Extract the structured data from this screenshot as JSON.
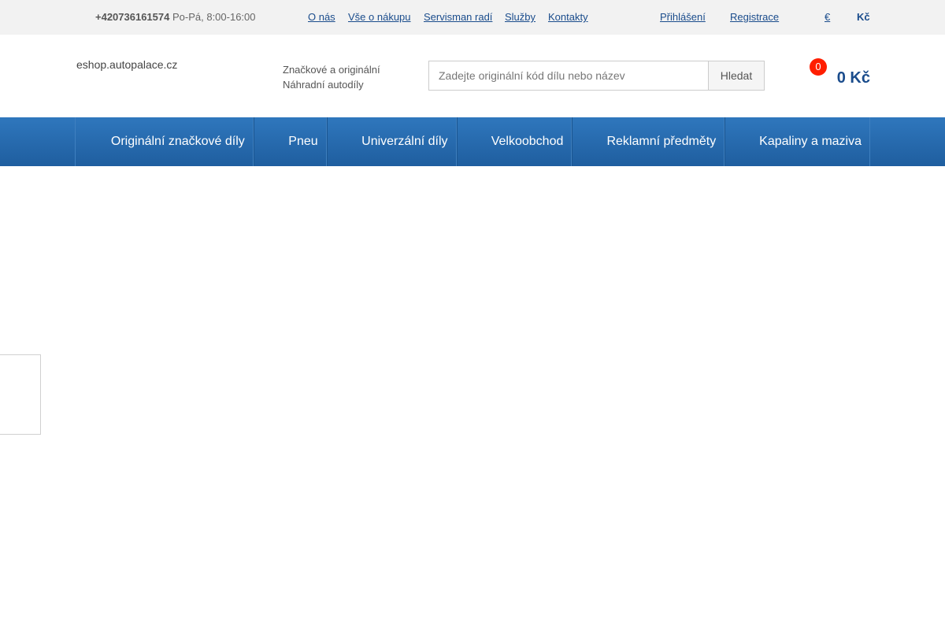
{
  "topbar": {
    "phone_number": "+420736161574",
    "hours": "Po-Pá, 8:00-16:00",
    "links": {
      "about": "O nás",
      "shopping": "Vše o nákupu",
      "advice": "Servisman radí",
      "services": "Služby",
      "contacts": "Kontakty",
      "login": "Přihlášení",
      "register": "Registrace"
    },
    "currencies": {
      "eur": "€",
      "czk": "Kč"
    }
  },
  "header": {
    "logo_alt": "eshop.autopalace.cz",
    "tagline_line1": "Značkové a originální",
    "tagline_line2": "Náhradní autodíly",
    "search": {
      "placeholder": "Zadejte originální kód dílu nebo název",
      "button_label": "Hledat"
    },
    "cart": {
      "count": "0",
      "total": "0 Kč"
    }
  },
  "nav": {
    "items": [
      "Originální značkové díly",
      "Pneu",
      "Univerzální díly",
      "Velkoobchod",
      "Reklamní předměty",
      "Kapaliny a maziva"
    ]
  },
  "colors": {
    "brand_blue": "#1a4c8c",
    "nav_blue": "#2668ad",
    "badge_red": "#ff1e00"
  },
  "icons": {
    "logo_image": "broken-image-icon"
  }
}
